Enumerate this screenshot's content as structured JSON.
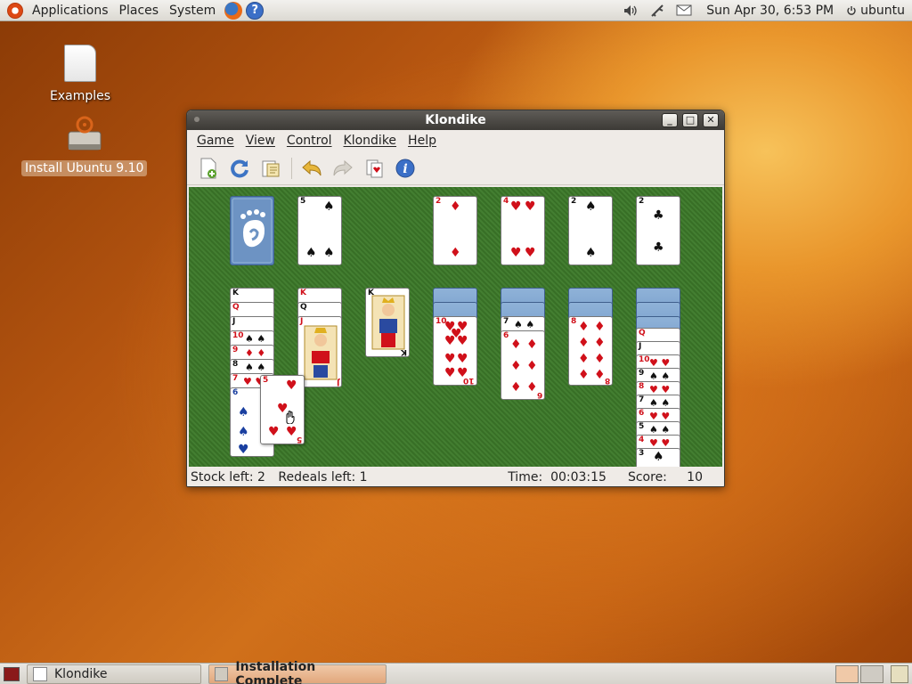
{
  "top_panel": {
    "applications": "Applications",
    "places": "Places",
    "system": "System",
    "clock": "Sun Apr 30,  6:53 PM",
    "user": "ubuntu"
  },
  "desktop": {
    "examples_label": "Examples",
    "installer_label": "Install Ubuntu 9.10"
  },
  "window": {
    "title": "Klondike",
    "menu": [
      "Game",
      "View",
      "Control",
      "Klondike",
      "Help"
    ],
    "status": {
      "stock": "Stock left: 2",
      "redeals": "Redeals left: 1",
      "time_label": "Time:",
      "time_value": "00:03:15",
      "score_label": "Score:",
      "score_value": "10"
    }
  },
  "cards": {
    "waste_top": "5",
    "foundation_1": "2",
    "foundation_2": "4",
    "foundation_3": "2",
    "foundation_4": "2",
    "tableau_3_top": "K",
    "dragged": "5"
  },
  "taskbar": {
    "klondike": "Klondike",
    "install": "Installation Complete"
  },
  "colors": {
    "felt": "#3d7a2a",
    "titlebar": "#4a4743",
    "accent": "#dd4814"
  }
}
